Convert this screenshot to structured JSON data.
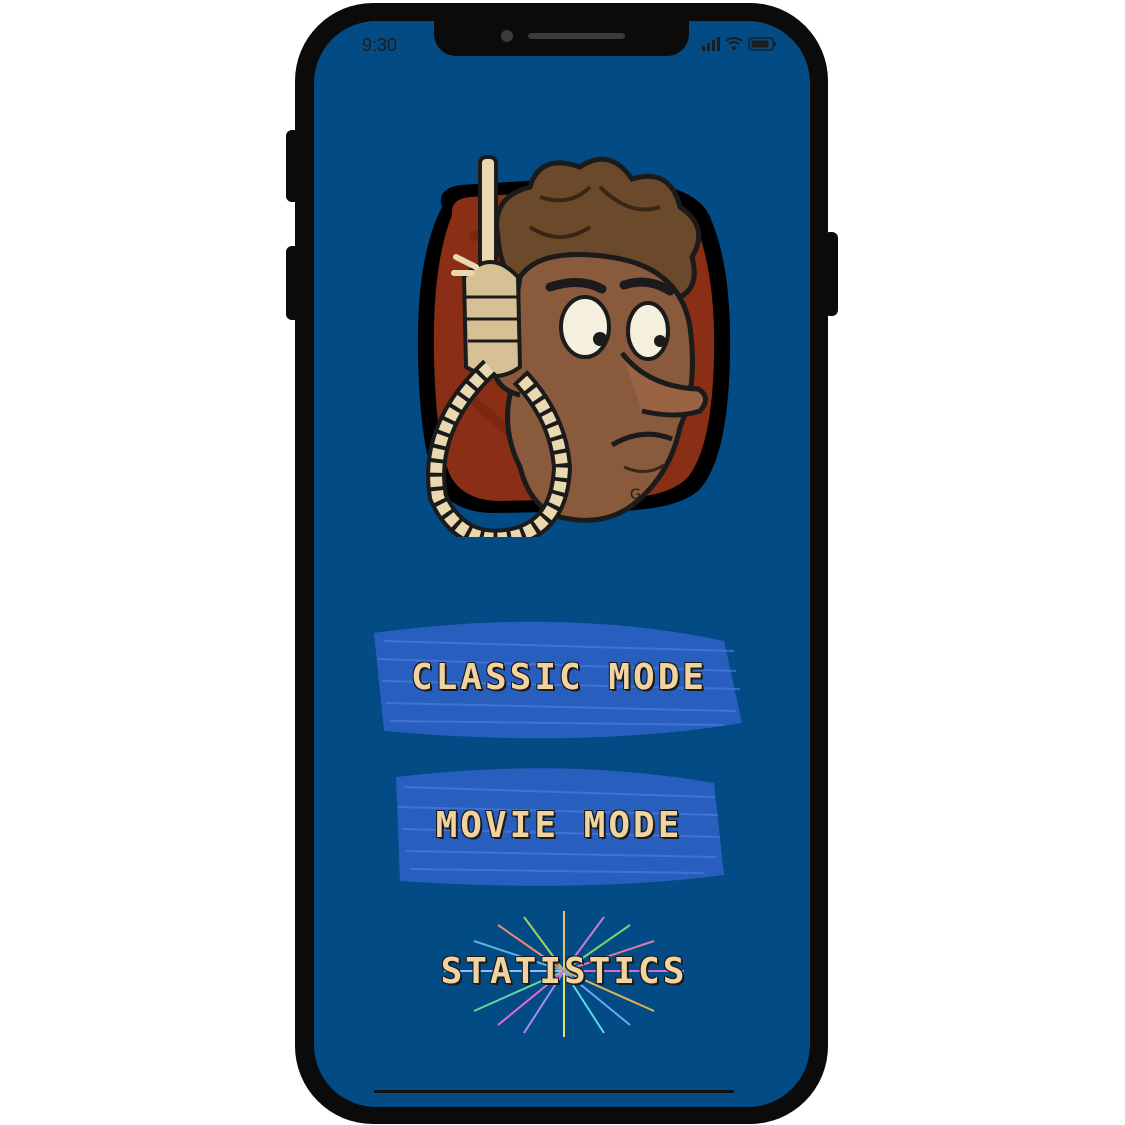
{
  "status_bar": {
    "time": "9:30"
  },
  "menu": {
    "classic_label": "CLASSIC MODE",
    "movie_label": "MOVIE MODE",
    "stats_label": "STATISTICS"
  },
  "colors": {
    "screen_bg": "#024b85",
    "button_scribble": "#2f63c8",
    "label_text": "#f1d3a0",
    "logo_backdrop": "#8a2f15"
  },
  "icons": {
    "status": [
      "signal-icon",
      "wifi-icon",
      "battery-icon"
    ],
    "logo": "hangman-face-logo",
    "stats_decoration": "fireworks-icon"
  }
}
